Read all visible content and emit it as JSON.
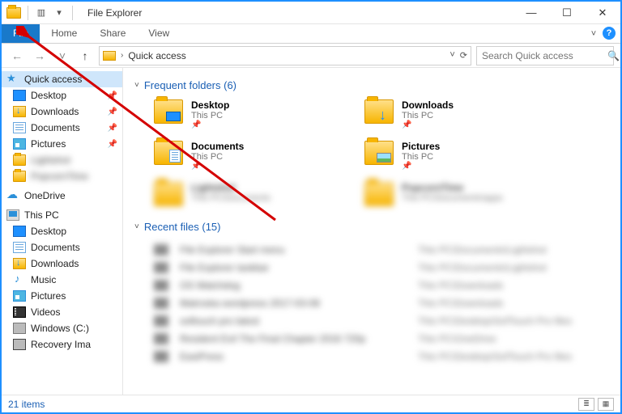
{
  "window": {
    "title": "File Explorer",
    "minimize": "—",
    "maximize": "☐",
    "close": "✕"
  },
  "ribbon": {
    "file": "File",
    "home": "Home",
    "share": "Share",
    "view": "View"
  },
  "nav": {
    "back_glyph": "←",
    "fwd_glyph": "→",
    "up_glyph": "↑",
    "down_glyph": "˅",
    "location": "Quick access",
    "refresh_glyph": "⟳",
    "dropdown_glyph": "˅"
  },
  "search": {
    "placeholder": "Search Quick access",
    "icon": "🔍"
  },
  "sidebar": {
    "quick_access": "Quick access",
    "quick_items": [
      {
        "label": "Desktop",
        "icon": "desktop",
        "pinned": true
      },
      {
        "label": "Downloads",
        "icon": "dl",
        "pinned": true
      },
      {
        "label": "Documents",
        "icon": "doc",
        "pinned": true
      },
      {
        "label": "Pictures",
        "icon": "pic",
        "pinned": true
      },
      {
        "label": "Lightshot",
        "icon": "folder",
        "pinned": false,
        "blur": true
      },
      {
        "label": "PopcornTime",
        "icon": "folder",
        "pinned": false,
        "blur": true
      }
    ],
    "onedrive": "OneDrive",
    "thispc": "This PC",
    "pc_items": [
      {
        "label": "Desktop",
        "icon": "desktop"
      },
      {
        "label": "Documents",
        "icon": "doc"
      },
      {
        "label": "Downloads",
        "icon": "dl"
      },
      {
        "label": "Music",
        "icon": "music"
      },
      {
        "label": "Pictures",
        "icon": "pic"
      },
      {
        "label": "Videos",
        "icon": "video"
      },
      {
        "label": "Windows (C:)",
        "icon": "disk"
      },
      {
        "label": "Recovery Ima",
        "icon": "disk2"
      }
    ]
  },
  "sections": {
    "frequent": {
      "title": "Frequent folders (6)",
      "count": 6
    },
    "recent": {
      "title": "Recent files (15)",
      "count": 15
    }
  },
  "frequent_folders": [
    {
      "name": "Desktop",
      "location": "This PC",
      "overlay": "screen",
      "pinned": true
    },
    {
      "name": "Downloads",
      "location": "This PC",
      "overlay": "arrow",
      "pinned": true
    },
    {
      "name": "Documents",
      "location": "This PC",
      "overlay": "page",
      "pinned": true
    },
    {
      "name": "Pictures",
      "location": "This PC",
      "overlay": "photo",
      "pinned": true
    },
    {
      "name": "Lightshot",
      "location": "This PC\\Documents",
      "blur": true
    },
    {
      "name": "PopcornTime",
      "location": "This PC\\Documents\\apps",
      "blur": true
    }
  ],
  "recent_files": [
    {
      "name": "File Explorer Start menu",
      "location": "This PC\\Documents\\Lightshot"
    },
    {
      "name": "File Explorer taskbar",
      "location": "This PC\\Documents\\Lightshot"
    },
    {
      "name": "OS Watchdog",
      "location": "This PC\\Downloads"
    },
    {
      "name": "Matroska wordpress 2017-03-08",
      "location": "This PC\\Downloads"
    },
    {
      "name": "softouch pro latest",
      "location": "This PC\\Desktop\\SofTouch Pro files"
    },
    {
      "name": "Resident Evil The Final Chapter 2016 720p",
      "location": "This PC\\OneDrive"
    },
    {
      "name": "EasiPress",
      "location": "This PC\\Desktop\\SofTouch Pro files"
    }
  ],
  "status": {
    "text": "21 items"
  },
  "colors": {
    "accent": "#1979ca",
    "link": "#1a5fb4",
    "border": "#1e90ff"
  }
}
